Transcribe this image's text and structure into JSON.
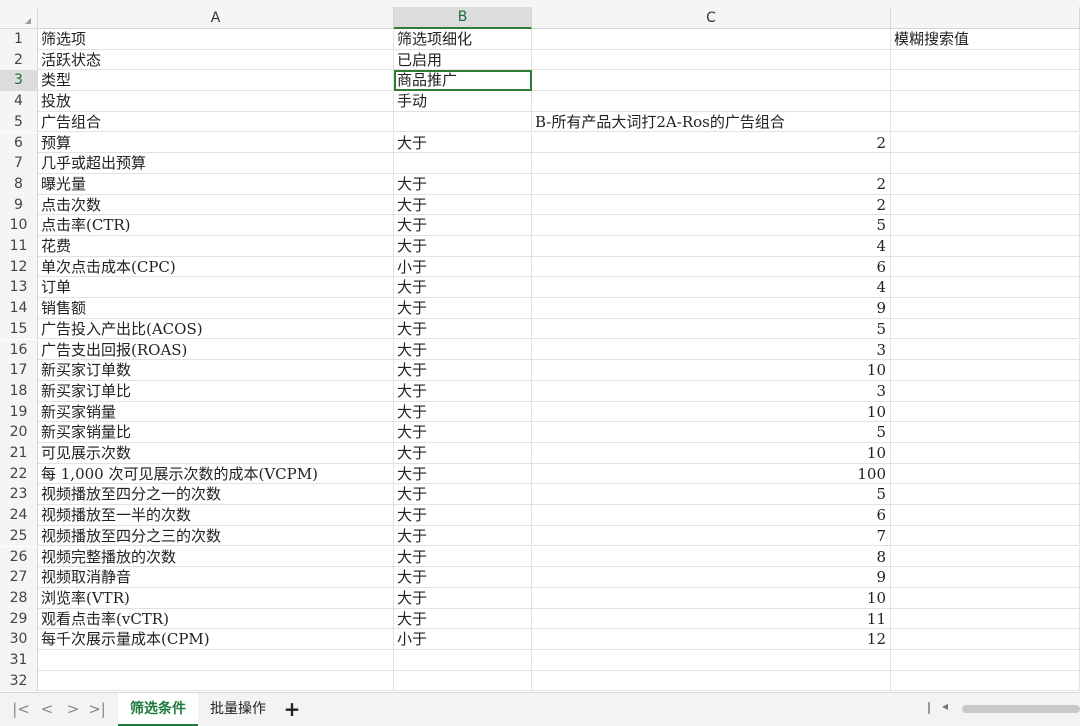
{
  "columns": [
    "A",
    "B",
    "C"
  ],
  "sheet": {
    "rows": [
      {
        "n": "1",
        "a": "筛选项",
        "b": "筛选项细化",
        "c": "",
        "d": "模糊搜索值"
      },
      {
        "n": "2",
        "a": "活跃状态",
        "b": "已启用",
        "c": "",
        "d": ""
      },
      {
        "n": "3",
        "a": "类型",
        "b": "商品推广",
        "c": "",
        "d": ""
      },
      {
        "n": "4",
        "a": "投放",
        "b": "手动",
        "c": "",
        "d": ""
      },
      {
        "n": "5",
        "a": "广告组合",
        "b": "",
        "c": "B-所有产品大词打2A-Ros的广告组合",
        "d": ""
      },
      {
        "n": "6",
        "a": "预算",
        "b": "大于",
        "c": "2",
        "d": ""
      },
      {
        "n": "7",
        "a": "几乎或超出预算",
        "b": "",
        "c": "",
        "d": ""
      },
      {
        "n": "8",
        "a": "曝光量",
        "b": "大于",
        "c": "2",
        "d": ""
      },
      {
        "n": "9",
        "a": "点击次数",
        "b": "大于",
        "c": "2",
        "d": ""
      },
      {
        "n": "10",
        "a": "点击率(CTR)",
        "b": "大于",
        "c": "5",
        "d": ""
      },
      {
        "n": "11",
        "a": "花费",
        "b": "大于",
        "c": "4",
        "d": ""
      },
      {
        "n": "12",
        "a": "单次点击成本(CPC)",
        "b": "小于",
        "c": "6",
        "d": ""
      },
      {
        "n": "13",
        "a": "订单",
        "b": "大于",
        "c": "4",
        "d": ""
      },
      {
        "n": "14",
        "a": "销售额",
        "b": "大于",
        "c": "9",
        "d": ""
      },
      {
        "n": "15",
        "a": "广告投入产出比(ACOS)",
        "b": "大于",
        "c": "5",
        "d": ""
      },
      {
        "n": "16",
        "a": "广告支出回报(ROAS)",
        "b": "大于",
        "c": "3",
        "d": ""
      },
      {
        "n": "17",
        "a": "新买家订单数",
        "b": "大于",
        "c": "10",
        "d": ""
      },
      {
        "n": "18",
        "a": "新买家订单比",
        "b": "大于",
        "c": "3",
        "d": ""
      },
      {
        "n": "19",
        "a": "新买家销量",
        "b": "大于",
        "c": "10",
        "d": ""
      },
      {
        "n": "20",
        "a": "新买家销量比",
        "b": "大于",
        "c": "5",
        "d": ""
      },
      {
        "n": "21",
        "a": "可见展示次数",
        "b": "大于",
        "c": "10",
        "d": ""
      },
      {
        "n": "22",
        "a": "每 1,000 次可见展示次数的成本(VCPM)",
        "b": "大于",
        "c": "100",
        "d": ""
      },
      {
        "n": "23",
        "a": "视频播放至四分之一的次数",
        "b": "大于",
        "c": "5",
        "d": ""
      },
      {
        "n": "24",
        "a": "视频播放至一半的次数",
        "b": "大于",
        "c": "6",
        "d": ""
      },
      {
        "n": "25",
        "a": "视频播放至四分之三的次数",
        "b": "大于",
        "c": "7",
        "d": ""
      },
      {
        "n": "26",
        "a": "视频完整播放的次数",
        "b": "大于",
        "c": "8",
        "d": ""
      },
      {
        "n": "27",
        "a": "视频取消静音",
        "b": "大于",
        "c": "9",
        "d": ""
      },
      {
        "n": "28",
        "a": "浏览率(VTR)",
        "b": "大于",
        "c": "10",
        "d": ""
      },
      {
        "n": "29",
        "a": "观看点击率(vCTR)",
        "b": "大于",
        "c": "11",
        "d": ""
      },
      {
        "n": "30",
        "a": "每千次展示量成本(CPM)",
        "b": "小于",
        "c": "12",
        "d": ""
      },
      {
        "n": "31",
        "a": "",
        "b": "",
        "c": "",
        "d": ""
      },
      {
        "n": "32",
        "a": "",
        "b": "",
        "c": "",
        "d": ""
      }
    ]
  },
  "tabs": {
    "nav": [
      "|<",
      "<",
      ">",
      ">|"
    ],
    "items": [
      "筛选条件",
      "批量操作"
    ],
    "add_label": "+",
    "scroll_left": "◂"
  }
}
